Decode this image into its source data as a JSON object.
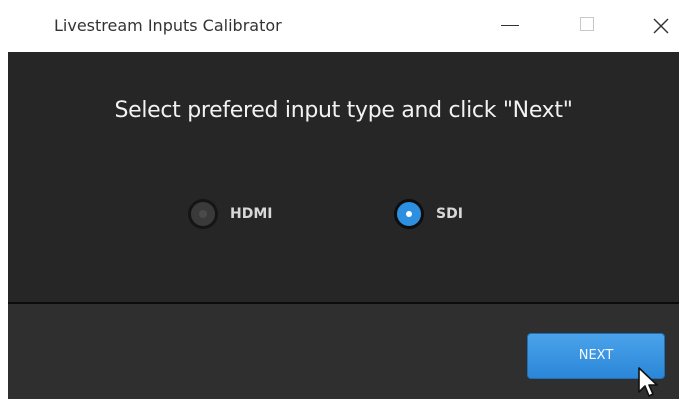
{
  "window": {
    "title": "Livestream Inputs Calibrator"
  },
  "dialog": {
    "prompt": "Select prefered input type and click \"Next\"",
    "options": [
      {
        "label": "HDMI",
        "selected": false
      },
      {
        "label": "SDI",
        "selected": true
      }
    ],
    "next_label": "NEXT"
  },
  "colors": {
    "panel_bg": "#262626",
    "footer_bg": "#2f2f2f",
    "accent": "#2d8fe0"
  },
  "icons": [
    "minimize-icon",
    "maximize-icon",
    "close-icon",
    "mouse-pointer-icon"
  ]
}
